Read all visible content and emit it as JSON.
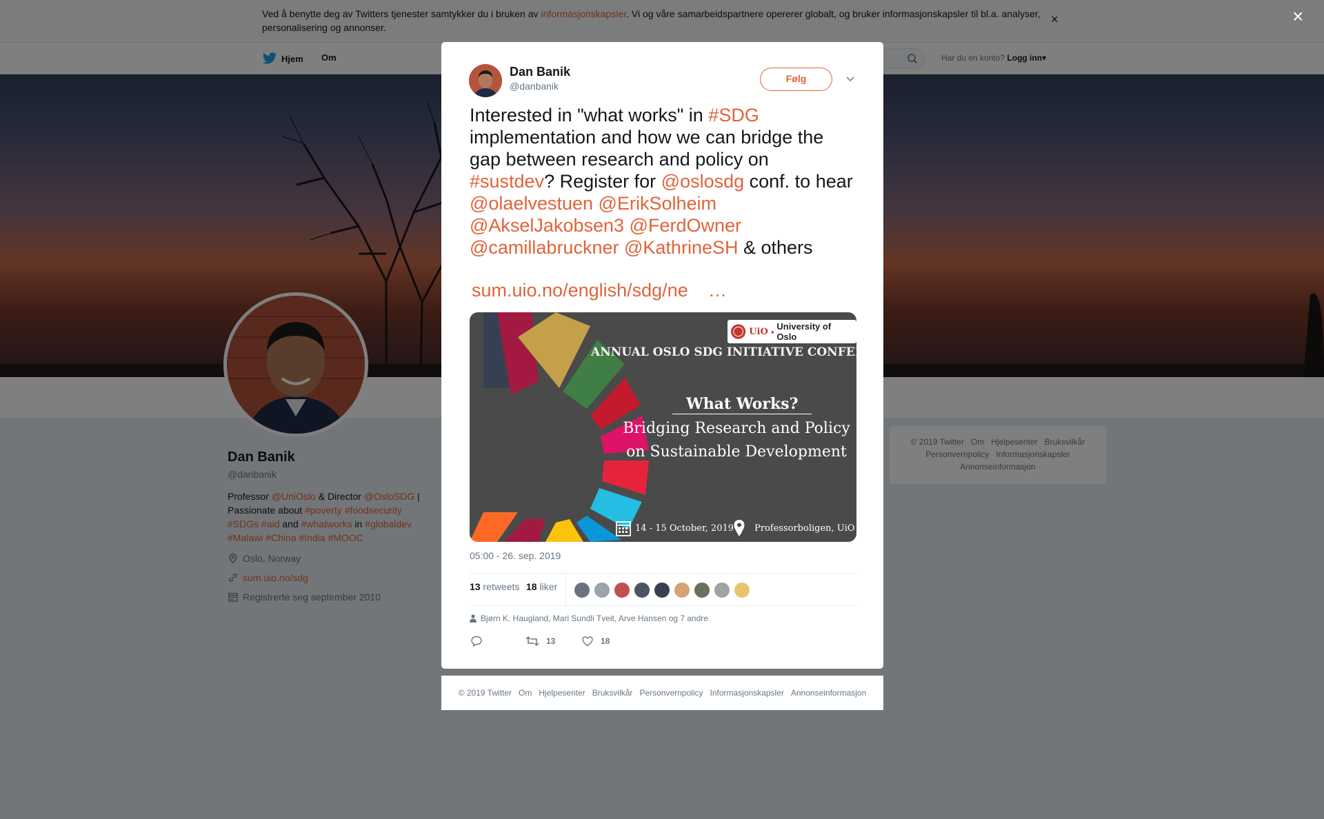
{
  "cookie": {
    "text_before": "Ved å benytte deg av Twitters tjenester samtykker du i bruken av ",
    "link": "informasjonskapsler",
    "text_after": ". Vi og våre samarbeidspartnere opererer globalt, og bruker informasjonskapsler til bl.a. analyser, personalisering og annonser.",
    "close": "×"
  },
  "nav": {
    "home": "Hjem",
    "about": "Om",
    "login_prompt": "Har du en konto?",
    "login": "Logg inn"
  },
  "profile": {
    "name": "Dan Banik",
    "handle": "@danbanik",
    "bio": [
      {
        "t": "Professor ",
        "a": false
      },
      {
        "t": "@UniOslo",
        "a": true
      },
      {
        "t": " & Director ",
        "a": false
      },
      {
        "t": "@OsloSDG",
        "a": true
      },
      {
        "t": " | Passionate about ",
        "a": false
      },
      {
        "t": "#poverty",
        "a": true
      },
      {
        "t": " ",
        "a": false
      },
      {
        "t": "#foodsecurity",
        "a": true
      },
      {
        "t": " ",
        "a": false
      },
      {
        "t": "#SDGs",
        "a": true
      },
      {
        "t": " ",
        "a": false
      },
      {
        "t": "#aid",
        "a": true
      },
      {
        "t": " and ",
        "a": false
      },
      {
        "t": "#whatworks",
        "a": true
      },
      {
        "t": " in ",
        "a": false
      },
      {
        "t": "#globaldev",
        "a": true
      },
      {
        "t": " ",
        "a": false
      },
      {
        "t": "#Malawi",
        "a": true
      },
      {
        "t": " ",
        "a": false
      },
      {
        "t": "#China",
        "a": true
      },
      {
        "t": " ",
        "a": false
      },
      {
        "t": "#India",
        "a": true
      },
      {
        "t": " ",
        "a": false
      },
      {
        "t": "#MOOC",
        "a": true
      }
    ],
    "location": "Oslo, Norway",
    "website": "sum.uio.no/sdg",
    "joined": "Registrerte seg september 2010"
  },
  "side_footer": [
    "© 2019 Twitter",
    "Om",
    "Hjelpesenter",
    "Bruksvilkår",
    "Personvernpolicy",
    "Informasjonskapsler",
    "Annonseinformasjon"
  ],
  "overlay_close": "×",
  "tweet": {
    "author_name": "Dan Banik",
    "author_handle": "@danbanik",
    "follow": "Følg",
    "text": [
      {
        "t": "Interested in \"what works\" in ",
        "a": false
      },
      {
        "t": "#SDG",
        "a": true
      },
      {
        "t": " implementation and how we can bridge the gap between research and policy on ",
        "a": false
      },
      {
        "t": "#sustdev",
        "a": true
      },
      {
        "t": "? Register for ",
        "a": false
      },
      {
        "t": "@oslosdg",
        "a": true
      },
      {
        "t": " conf. to hear ",
        "a": false
      },
      {
        "t": "@olaelvestuen",
        "a": true
      },
      {
        "t": " ",
        "a": false
      },
      {
        "t": "@ErikSolheim",
        "a": true
      },
      {
        "t": " ",
        "a": false
      },
      {
        "t": "@AkselJakobsen3",
        "a": true
      },
      {
        "t": " ",
        "a": false
      },
      {
        "t": "@FerdOwner",
        "a": true
      },
      {
        "t": " ",
        "a": false
      },
      {
        "t": "@camillabruckner",
        "a": true
      },
      {
        "t": " ",
        "a": false
      },
      {
        "t": "@KathrineSH",
        "a": true
      },
      {
        "t": " & others",
        "a": false
      }
    ],
    "link": "sum.uio.no/english/sdg/ne",
    "link_ellipsis": "…",
    "card": {
      "uio": "UiO",
      "university": "University of Oslo",
      "title": "ANNUAL OSLO SDG INITIATIVE CONFERENCE",
      "headline": "What Works?",
      "subtitle": "Bridging Research and Policy on Sustainable Development",
      "date": "14 - 15 October,  2019",
      "place": "Professorboligen, UiO"
    },
    "timestamp": "05:00 - 26. sep. 2019",
    "retweets_count": "13",
    "retweets_label": "retweets",
    "likes_count": "18",
    "likes_label": "liker",
    "likers": "Bjørn K. Haugland, Mari Sundli Tveit, Arve Hansen og 7 andre",
    "action_retweets": "13",
    "action_likes": "18",
    "facepile_colors": [
      "#6b7280",
      "#9ca3af",
      "#c0504d",
      "#4b5563",
      "#374151",
      "#d4a373",
      "#6b705c",
      "#a3a3a3",
      "#e9c46a"
    ]
  },
  "modal_footer": [
    "© 2019 Twitter",
    "Om",
    "Hjelpesenter",
    "Bruksvilkår",
    "Personvernpolicy",
    "Informasjonskapsler",
    "Annonseinformasjon"
  ]
}
